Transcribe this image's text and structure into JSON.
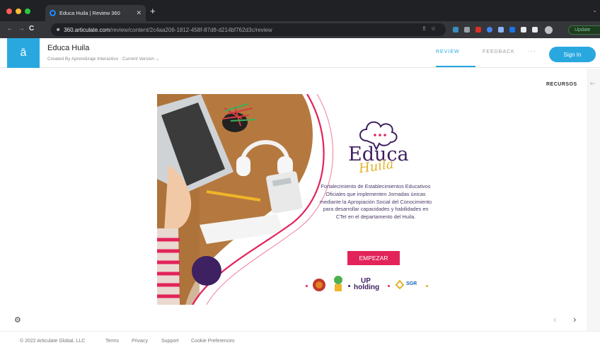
{
  "browser": {
    "tab_title": "Educa Huila | Review 360",
    "url_host": "360.articulate.com",
    "url_path": "/review/content/2c4aa206-1812-458f-87d8-d214bf762d3c/review",
    "update_label": "Update",
    "traffic_colors": [
      "#ff5f57",
      "#febc2e",
      "#28c840"
    ]
  },
  "header": {
    "logo_letter": "ā",
    "course_title": "Educa Huila",
    "course_subtitle": "Created By Aprendizaje Interactivo · Current Version ⌄",
    "nav_review": "REVIEW",
    "nav_feedback": "FEEDBACK",
    "nav_more": "···",
    "signin_label": "Sign In"
  },
  "sidebar": {
    "recursos_label": "RECURSOS"
  },
  "slide": {
    "brand_educa": "Educa",
    "brand_huila": "Huila",
    "description": "Fortalecimiento de Establecimientos Educativos Oficiales que implementen Jornadas únicas mediante la Apropiación Social del Conocimiento para desarrollar capacidades y habilidades en CTeI en el departamento del Huila.",
    "start_button": "EMPEZAR",
    "partner_logo_upholding": "UP holding",
    "partner_logo_sgr": "SGR",
    "colors": {
      "accent": "#e2245a",
      "purple": "#3e2161",
      "gold": "#e3b02a",
      "wood": "#b5793f"
    }
  },
  "footer": {
    "copyright": "© 2022 Articulate Global, LLC",
    "terms": "Terms",
    "privacy": "Privacy",
    "support": "Support",
    "cookies": "Cookie Preferences"
  }
}
